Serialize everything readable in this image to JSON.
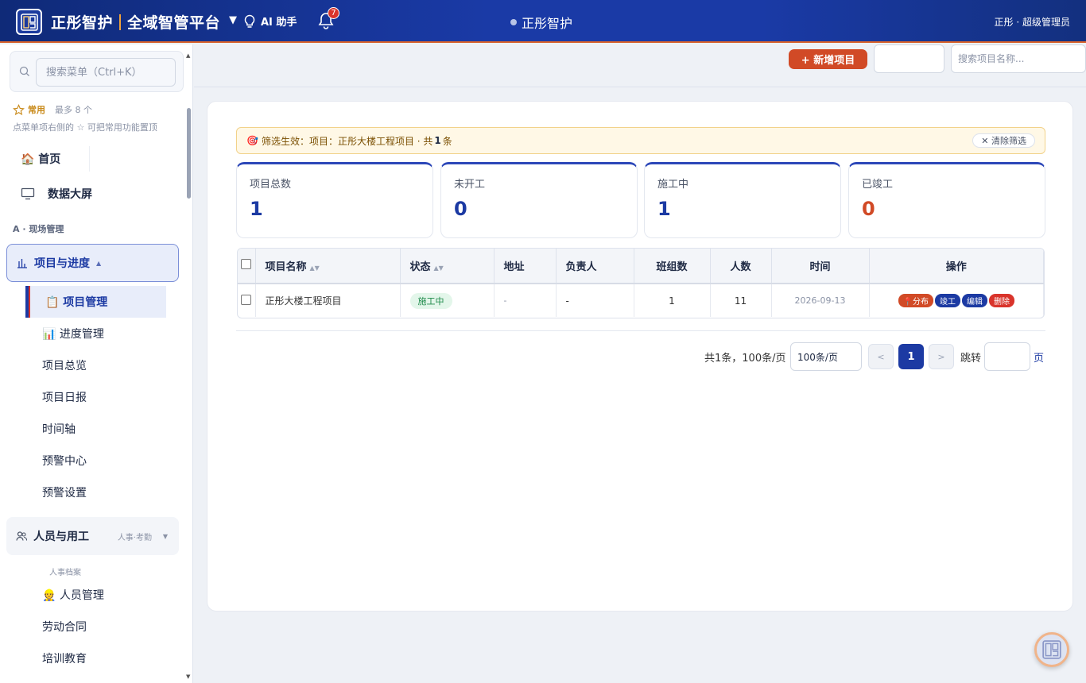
{
  "header": {
    "brand_name": "正彤智护",
    "platform_name": "全域智管平台",
    "ai_label": "AI 助手",
    "notification_count": "7",
    "center_title": "正彤智护",
    "user_info": "正彤 · 超级管理员"
  },
  "sidebar": {
    "search_placeholder": "搜索菜单（Ctrl+K）",
    "favorites_label": "常用",
    "favorites_max": "最多 8 个",
    "favorites_hint": "点菜单项右侧的 ☆ 可把常用功能置顶",
    "home_label": "🏠 首页",
    "screen_label": "数据大屏",
    "section_a": "A · 现场管理",
    "group_project": "项目与进度",
    "project_items": [
      "📋 项目管理",
      "📊 进度管理",
      "项目总览",
      "项目日报",
      "时间轴",
      "预警中心",
      "预警设置"
    ],
    "group_people": "人员与用工",
    "group_people_tag": "人事·考勤",
    "people_sub_label": "人事档案",
    "people_items": [
      "👷 人员管理",
      "劳动合同",
      "培训教育"
    ]
  },
  "toolbar": {
    "add_label": "+ 新增项目",
    "search_placeholder": "搜索项目名称..."
  },
  "filter": {
    "icon": "🎯",
    "prefix": "筛选生效：项目：正彤大楼工程项目 · 共",
    "count": "1",
    "suffix": "条",
    "clear_label": "✕ 清除筛选"
  },
  "stats": [
    {
      "label": "项目总数",
      "value": "1"
    },
    {
      "label": "未开工",
      "value": "0"
    },
    {
      "label": "施工中",
      "value": "1"
    },
    {
      "label": "已竣工",
      "value": "0"
    }
  ],
  "table": {
    "headers": [
      "项目名称",
      "状态",
      "地址",
      "负责人",
      "班组数",
      "人数",
      "时间",
      "操作"
    ],
    "rows": [
      {
        "name": "正彤大楼工程项目",
        "status": "施工中",
        "address": "-",
        "manager": "-",
        "teams": "1",
        "people": "11",
        "date": "2026-09-13",
        "ops": [
          "📍分布",
          "竣工",
          "编辑",
          "删除"
        ]
      }
    ]
  },
  "pagination": {
    "total_text": "共1条，100条/页",
    "page_size": "100条/页",
    "prev": "<",
    "current": "1",
    "next": ">",
    "jump_label": "跳转",
    "page_unit": "页"
  },
  "colors": {
    "primary": "#1c3aa3",
    "accent": "#d14a26",
    "danger": "#d9342b",
    "success": "#1e8a4a"
  }
}
